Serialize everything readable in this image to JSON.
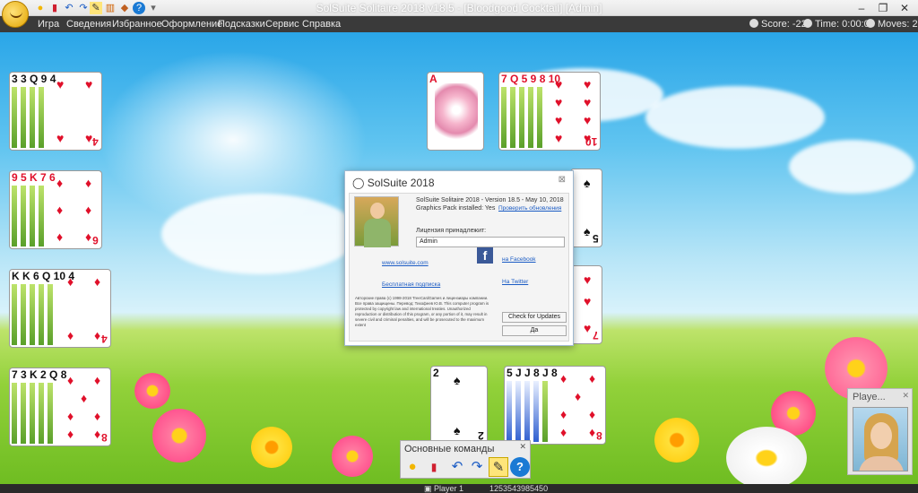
{
  "window": {
    "title": "SolSuite Solitaire 2018 v18.5 - [Bloodgood Cocktail]  [Admin]"
  },
  "menu": [
    "Игра",
    "Сведения",
    "Избранное",
    "Оформление",
    "Подсказки",
    "Сервис",
    "Справка"
  ],
  "stats": {
    "score": "Score: -22",
    "time": "Time: 0:00:08",
    "moves": "Moves: 2"
  },
  "tableau_left": [
    {
      "ranks": "3 3 Q 9 4",
      "top_rank": "4",
      "suit": "♥"
    },
    {
      "ranks": "9 5 K 7 6",
      "top_rank": "6",
      "suit": "♦"
    },
    {
      "ranks": "K K 6 Q 10 4",
      "top_rank": "4",
      "suit": "♦"
    },
    {
      "ranks": "7 3 K 2 Q 8",
      "top_rank": "8",
      "suit": "♦"
    }
  ],
  "foundation": {
    "rank": "A",
    "suit": "♥"
  },
  "tableau_top_right": {
    "ranks": "7 Q 5 9 8 10",
    "top_rank": "10",
    "suit": "♥"
  },
  "tableau_bottom": [
    {
      "rank": "2",
      "suit": "♠"
    },
    {
      "ranks": "5 J J 8 J 8",
      "top_rank": "8",
      "suit": "♦"
    }
  ],
  "partial_cards": [
    {
      "rank": "5",
      "suit": "♠"
    },
    {
      "rank": "7",
      "suit": "♥"
    }
  ],
  "about": {
    "title": "SolSuite 2018",
    "version": "SolSuite Solitaire 2018 - Version 18.5 - May 10, 2018",
    "graphics": "Graphics Pack installed: Yes",
    "check_link": "Проверить обновления",
    "licensed_label": "Лицензия принадлежит:",
    "licensee": "Admin",
    "website": "www.solsuite.com",
    "facebook": "на Facebook",
    "newsletter": "Бесплатная подписка",
    "twitter": "На Twitter",
    "legal": "Авторские права (c) 1998-2018 TreeCardGames и лицензиары компании. Все права защищены. Перевод: Тихофеев Ю.В. This computer program is protected by copyright law and international treaties. Unauthorized reproduction or distribution of this program, or any portion of it, may result in severe civil and criminal penalties, and will be prosecuted to the maximum extent",
    "check_button": "Check for Updates",
    "ok_button": "Да"
  },
  "commands": {
    "title": "Основные команды"
  },
  "player": {
    "panel_label": "Playe...",
    "status_name": "Player 1",
    "status_id": "1253543985450"
  }
}
